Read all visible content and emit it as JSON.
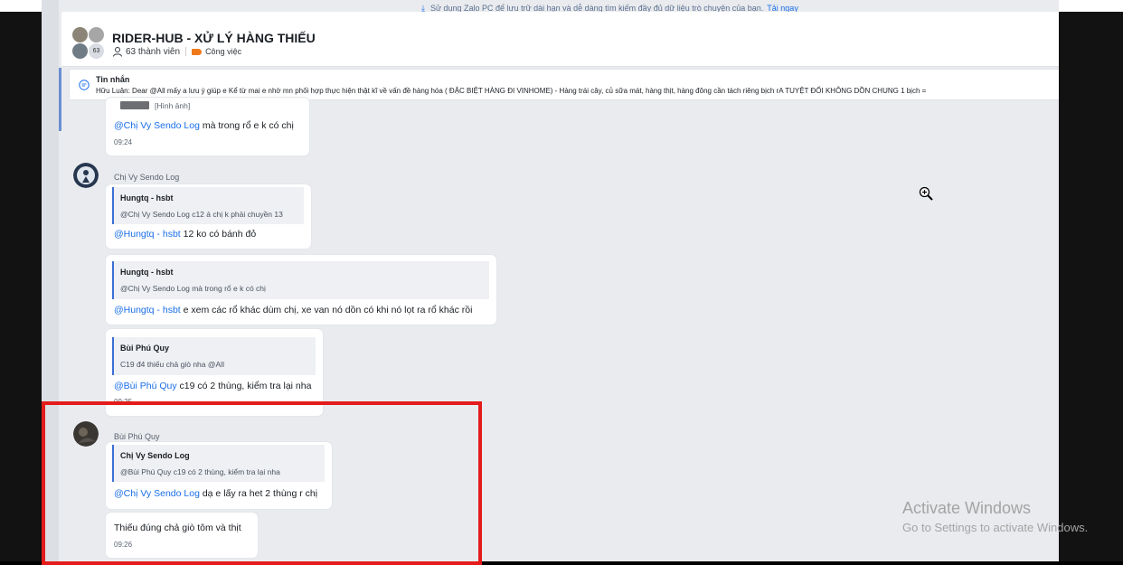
{
  "banner": {
    "text": "Sử dụng Zalo PC để lưu trữ dài hạn và dễ dàng tìm kiếm đầy đủ dữ liệu trò chuyện của bạn.",
    "link": "Tải ngay"
  },
  "header": {
    "group_name": "RIDER-HUB - XỬ LÝ HÀNG THIẾU",
    "member_count_badge": "63",
    "members_label": "63 thành viên",
    "tag_label": "Công việc"
  },
  "pinned": {
    "title": "Tin nhắn",
    "text": "Hữu Luân: Dear @All mấy a lưu ý giúp e  Kể từ mai e nhờ mn phối hợp thực hiện thật kĩ về vấn đề hàng hóa ( ĐẶC BIỆT HÀNG ĐI VINHOME) - Hàng trái cây, củ sữa mát, hàng thịt, hàng đông cần tách riêng bịch rA TUYỆT ĐỐI KHÔNG DỒN CHUNG 1 bịch ="
  },
  "messages": {
    "m0": {
      "image_label": "[Hình ảnh]",
      "mention": "@Chị Vy Sendo Log",
      "text": " mà trong rổ e k có chị",
      "time": "09:24"
    },
    "m1": {
      "sender": "Chị Vy Sendo Log",
      "quote_name": "Hungtq - hsbt",
      "quote_text": "@Chị Vy Sendo Log c12 á chị k phải chuyền 13",
      "mention": "@Hungtq - hsbt",
      "text": " 12 ko có bánh đỏ"
    },
    "m2": {
      "quote_name": "Hungtq - hsbt",
      "quote_text": "@Chị Vy Sendo Log mà trong rổ e k có chị",
      "mention": "@Hungtq - hsbt",
      "text": " e xem các rổ khác dùm chị, xe van nó dồn có khi nó lọt ra rổ khác rồi"
    },
    "m3": {
      "quote_name": "Bùi Phú Quy",
      "quote_text": "C19 đ4 thiếu chả giò nha @All",
      "mention": "@Bùi Phú Quy",
      "text": " c19 có 2 thùng, kiểm tra lại nha",
      "time": "09:25"
    },
    "m4": {
      "sender": "Bùi Phú Quy",
      "quote_name": "Chị Vy Sendo Log",
      "quote_text": "@Bùi Phú Quy c19 có 2 thùng, kiểm tra lại nha",
      "mention": "@Chị Vy Sendo Log",
      "text": " dạ e lấy ra het 2 thùng r chị"
    },
    "m5": {
      "text": "Thiếu đúng chả giò tôm và thịt",
      "time": "09:26"
    }
  },
  "watermark": {
    "title": "Activate Windows",
    "subtitle": "Go to Settings to activate Windows."
  },
  "colors": {
    "accent_blue": "#1a6ee8",
    "highlight_red": "#e41b1b",
    "tag_orange": "#f07a1a",
    "chat_bg": "#e9ebee"
  },
  "icons": [
    "download-icon",
    "person-icon",
    "tag-icon",
    "pinned-message-icon",
    "zoom-in-cursor-icon"
  ]
}
